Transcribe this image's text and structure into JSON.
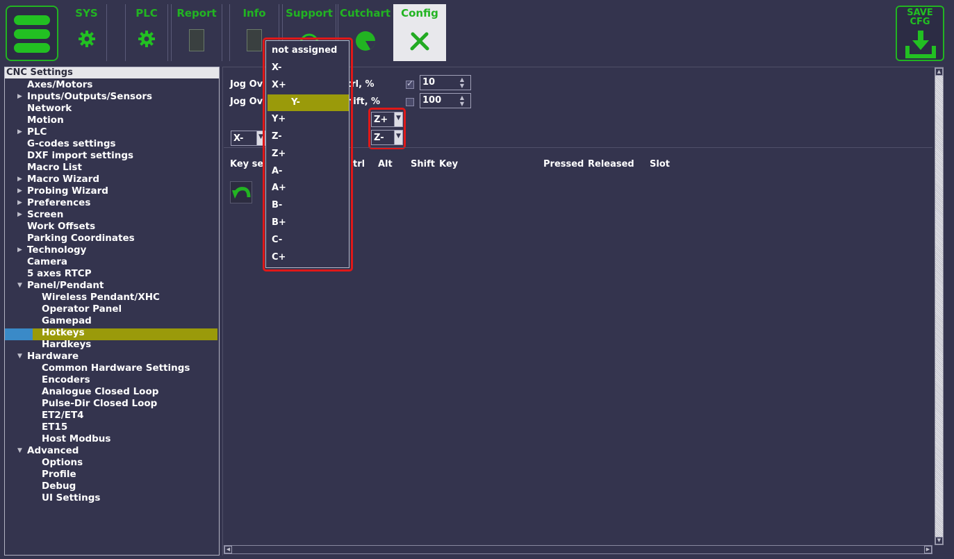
{
  "toolbar": {
    "tabs": [
      {
        "label": "SYS",
        "icon": "gear-icon"
      },
      {
        "label": "PLC",
        "icon": "gear-icon"
      },
      {
        "label": "Report",
        "icon": "document-icon"
      },
      {
        "label": "Info",
        "icon": "document-icon"
      },
      {
        "label": "Support",
        "icon": "support-icon"
      },
      {
        "label": "Cutchart",
        "icon": "pie-chart-icon"
      },
      {
        "label": "Config",
        "icon": "tools-icon"
      }
    ],
    "active_tab": "Config",
    "save_label": "SAVE\nCFG",
    "accent_color": "#22b422"
  },
  "tree": {
    "header": "CNC Settings",
    "items": [
      {
        "label": "Axes/Motors"
      },
      {
        "label": "Inputs/Outputs/Sensors"
      },
      {
        "label": "Network"
      },
      {
        "label": "Motion"
      },
      {
        "label": "PLC"
      },
      {
        "label": "G-codes settings"
      },
      {
        "label": "DXF import settings"
      },
      {
        "label": "Macro List"
      },
      {
        "label": "Macro Wizard"
      },
      {
        "label": "Probing Wizard"
      },
      {
        "label": "Preferences"
      },
      {
        "label": "Screen"
      },
      {
        "label": "Work Offsets"
      },
      {
        "label": "Parking Coordinates"
      },
      {
        "label": "Technology"
      },
      {
        "label": "Camera"
      },
      {
        "label": "5 axes RTCP"
      },
      {
        "label": "Panel/Pendant"
      },
      {
        "label": "Wireless Pendant/XHC"
      },
      {
        "label": "Operator Panel"
      },
      {
        "label": "Gamepad"
      },
      {
        "label": "Hotkeys"
      },
      {
        "label": "Hardkeys"
      },
      {
        "label": "Hardware"
      },
      {
        "label": "Common Hardware Settings"
      },
      {
        "label": "Encoders"
      },
      {
        "label": "Analogue Closed Loop"
      },
      {
        "label": "Pulse-Dir Closed Loop"
      },
      {
        "label": "ET2/ET4"
      },
      {
        "label": "ET15"
      },
      {
        "label": "Host Modbus"
      },
      {
        "label": "Advanced"
      },
      {
        "label": "Options"
      },
      {
        "label": "Profile"
      },
      {
        "label": "Debug"
      },
      {
        "label": "UI Settings"
      }
    ],
    "selected": "Hotkeys",
    "selection_color": "#9a9a0a"
  },
  "main": {
    "jog_ctrl_label_start": "Jog Ov",
    "jog_ctrl_label_end": "trl, %",
    "jog_ctrl_checked": true,
    "jog_ctrl_value": "10",
    "jog_shift_label_start": "Jog Ov",
    "jog_shift_label_end": "hift, %",
    "jog_shift_checked": false,
    "jog_shift_value": "100",
    "combo_left": "X-",
    "combo_z_plus": "Z+",
    "combo_z_minus": "Z-",
    "table_headers": {
      "key_seq": "Key se",
      "ctrl": "trl",
      "alt": "Alt",
      "shift": "Shift",
      "key": "Key",
      "pressed": "Pressed",
      "released": "Released",
      "slot": "Slot"
    }
  },
  "dropdown": {
    "options": [
      "not assigned",
      "X-",
      "X+",
      "Y-",
      "Y+",
      "Z-",
      "Z+",
      "A-",
      "A+",
      "B-",
      "B+",
      "C-",
      "C+"
    ],
    "selected": "Y-"
  }
}
